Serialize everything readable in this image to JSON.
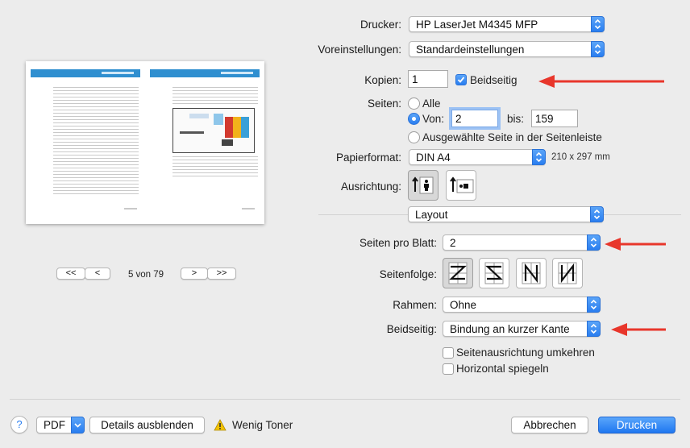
{
  "preview": {
    "page_indicator": "5 von 79",
    "nav": {
      "first": "<<",
      "prev": "<",
      "next": ">",
      "last": ">>"
    }
  },
  "printer": {
    "label": "Drucker:",
    "value": "HP LaserJet M4345 MFP"
  },
  "presets": {
    "label": "Voreinstellungen:",
    "value": "Standardeinstellungen"
  },
  "copies": {
    "label": "Kopien:",
    "value": "1",
    "duplex_label": "Beidseitig",
    "duplex_checked": true
  },
  "pages": {
    "label": "Seiten:",
    "all_label": "Alle",
    "from_label": "Von:",
    "from_value": "2",
    "to_label": "bis:",
    "to_value": "159",
    "selected_label": "Ausgewählte Seite in der Seitenleiste"
  },
  "paper": {
    "label": "Papierformat:",
    "value": "DIN A4",
    "size": "210 x 297 mm"
  },
  "orientation": {
    "label": "Ausrichtung:",
    "selected": "portrait"
  },
  "section": {
    "value": "Layout"
  },
  "pages_per_sheet": {
    "label": "Seiten pro Blatt:",
    "value": "2"
  },
  "page_order": {
    "label": "Seitenfolge:",
    "options": [
      "z-icon",
      "reverse-z-icon",
      "n-icon",
      "reverse-n-icon"
    ],
    "selected": 0
  },
  "border": {
    "label": "Rahmen:",
    "value": "Ohne"
  },
  "duplex": {
    "label": "Beidseitig:",
    "value": "Bindung an kurzer Kante"
  },
  "reverse_orientation": {
    "label": "Seitenausrichtung umkehren",
    "checked": false
  },
  "flip_horizontal": {
    "label": "Horizontal spiegeln",
    "checked": false
  },
  "footer": {
    "help": "?",
    "pdf": "PDF",
    "details": "Details ausblenden",
    "toner_warning": "Wenig Toner",
    "cancel": "Abbrechen",
    "print": "Drucken"
  },
  "colors": {
    "accent": "#2a7ef0",
    "annotation_arrow": "#e8362b"
  }
}
